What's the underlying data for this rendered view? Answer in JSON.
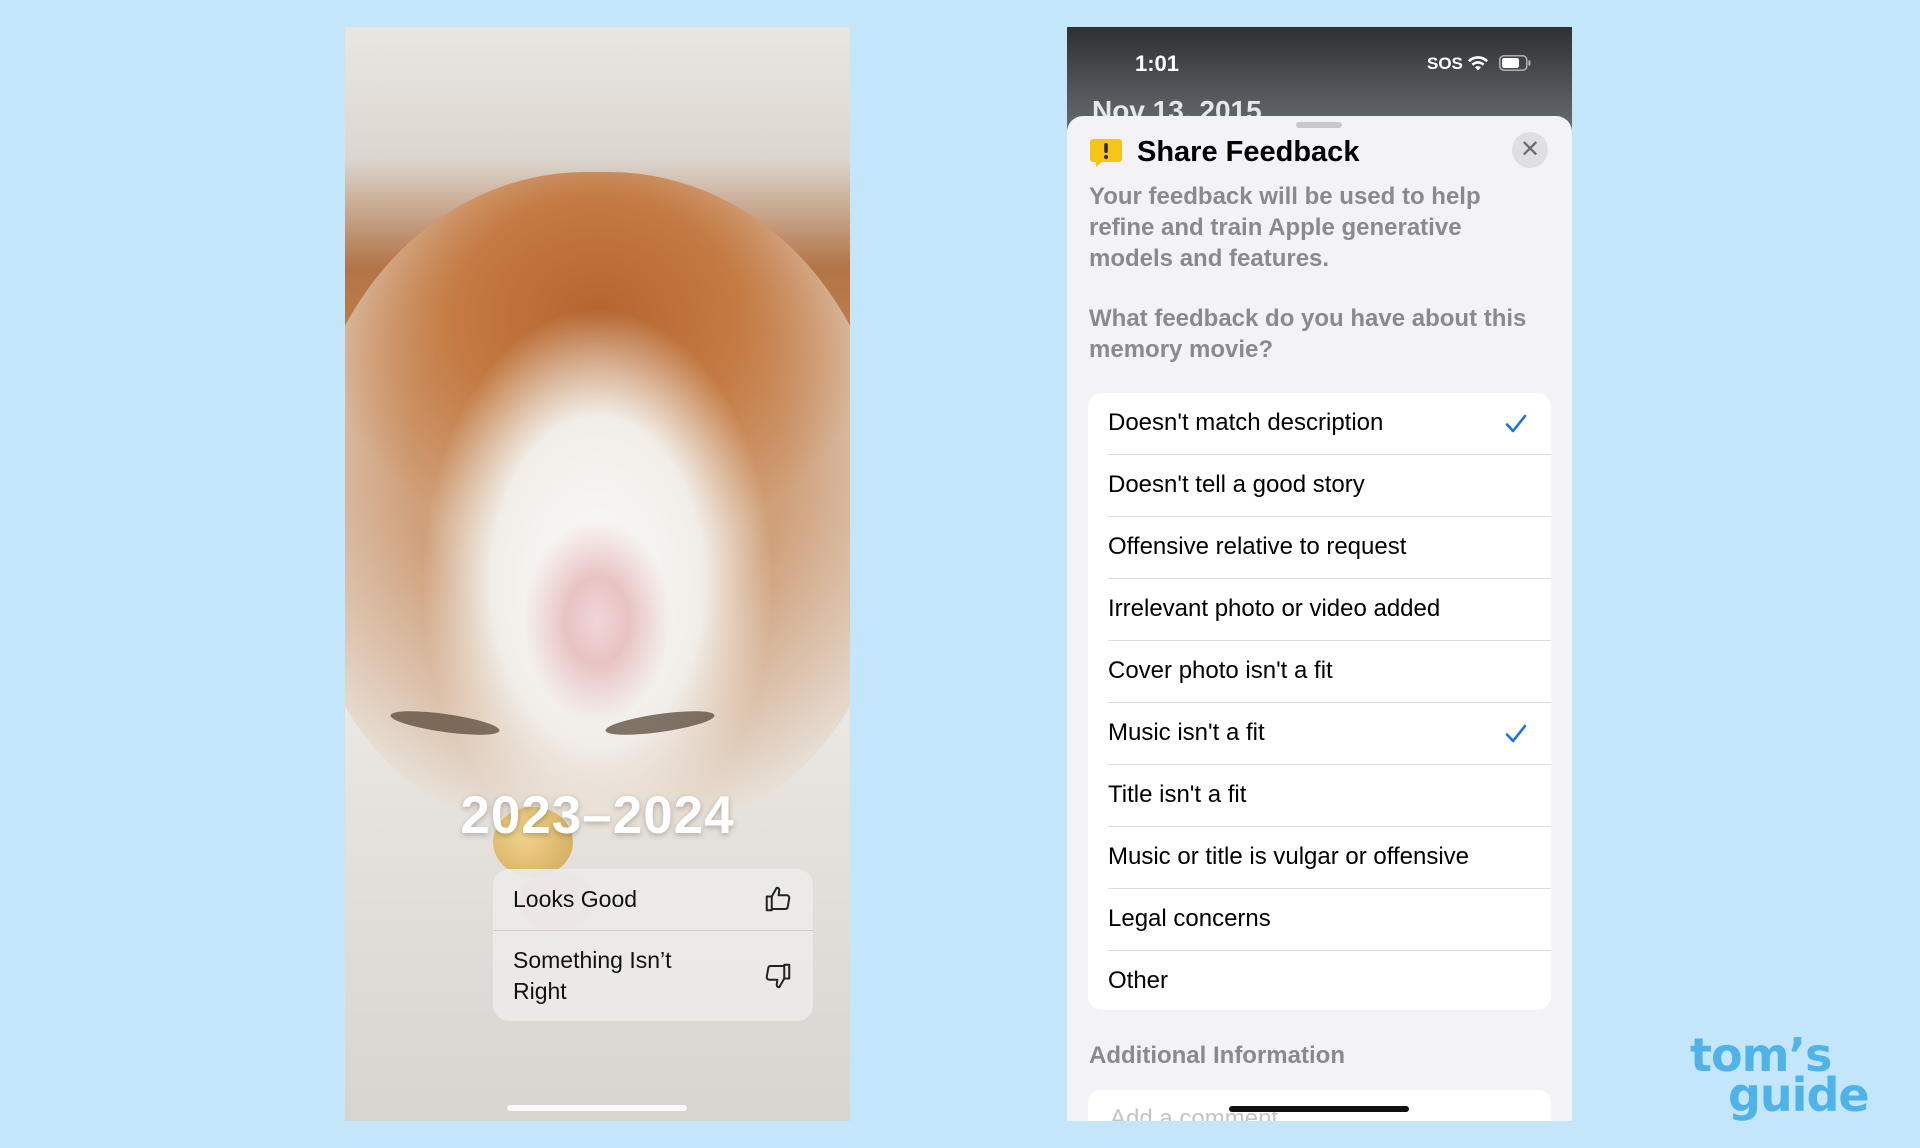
{
  "left_phone": {
    "title_overlay": "2023–2024",
    "menu": {
      "looks_good": "Looks Good",
      "something_wrong": "Something Isn’t Right"
    }
  },
  "right_phone": {
    "status_bar": {
      "time": "1:01",
      "carrier": "SOS"
    },
    "background_date": "Nov 13, 2015",
    "sheet": {
      "title": "Share Feedback",
      "close_symbol": "✕",
      "description": "Your feedback will be used to help refine and train Apple generative models and features.",
      "question": "What feedback do you have about this memory movie?",
      "options": [
        {
          "label": "Doesn't match description",
          "checked": true
        },
        {
          "label": "Doesn't tell a good story",
          "checked": false
        },
        {
          "label": "Offensive relative to request",
          "checked": false
        },
        {
          "label": "Irrelevant photo or video added",
          "checked": false
        },
        {
          "label": "Cover photo isn't a fit",
          "checked": false
        },
        {
          "label": "Music isn't a fit",
          "checked": true
        },
        {
          "label": "Title isn't a fit",
          "checked": false
        },
        {
          "label": "Music or title is vulgar or offensive",
          "checked": false
        },
        {
          "label": "Legal concerns",
          "checked": false
        },
        {
          "label": "Other",
          "checked": false
        }
      ],
      "additional_info_label": "Additional Information",
      "comment_placeholder": "Add a comment"
    }
  },
  "watermark": {
    "line1": "tom’s",
    "line2": "guide"
  },
  "colors": {
    "background": "#c4e6fb",
    "checkmark": "#1a73e8",
    "alert_badge": "#f5c518",
    "watermark": "#4fb3ea"
  }
}
